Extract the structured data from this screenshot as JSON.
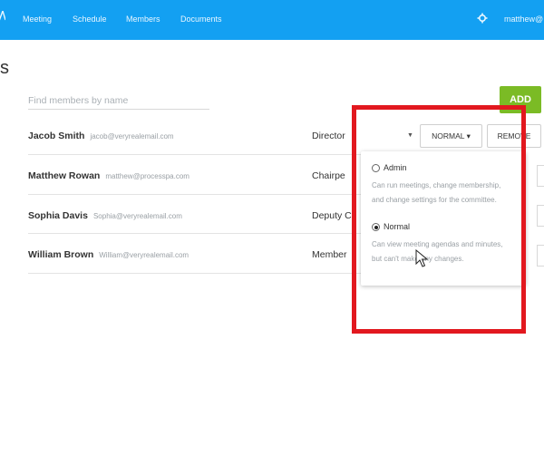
{
  "nav": {
    "items": [
      "Meeting",
      "Schedule",
      "Members",
      "Documents"
    ],
    "user": "matthew@"
  },
  "page": {
    "title_fragment": "s"
  },
  "search": {
    "placeholder": "Find members by name"
  },
  "add_button": {
    "label": "ADD"
  },
  "members": [
    {
      "name": "Jacob Smith",
      "email": "jacob@veryrealemail.com",
      "role": "Director"
    },
    {
      "name": "Matthew Rowan",
      "email": "matthew@processpa.com",
      "role": "Chairpe"
    },
    {
      "name": "Sophia Davis",
      "email": "Sophia@veryrealemail.com",
      "role": "Deputy C"
    },
    {
      "name": "William Brown",
      "email": "William@veryrealemail.com",
      "role": "Member"
    }
  ],
  "actions": {
    "normal_label": "NORMAL ▾",
    "remove_label": "REMOVE"
  },
  "permission_menu": {
    "options": [
      {
        "label": "Admin",
        "selected": false,
        "desc_line1": "Can run meetings, change membership,",
        "desc_line2": "and change settings for the committee."
      },
      {
        "label": "Normal",
        "selected": true,
        "desc_line1": "Can view meeting agendas and minutes,",
        "desc_line2": "but can't make any changes."
      }
    ]
  },
  "colors": {
    "topbar": "#13a0f2",
    "add": "#7bbb25",
    "highlight": "#e2181f"
  }
}
